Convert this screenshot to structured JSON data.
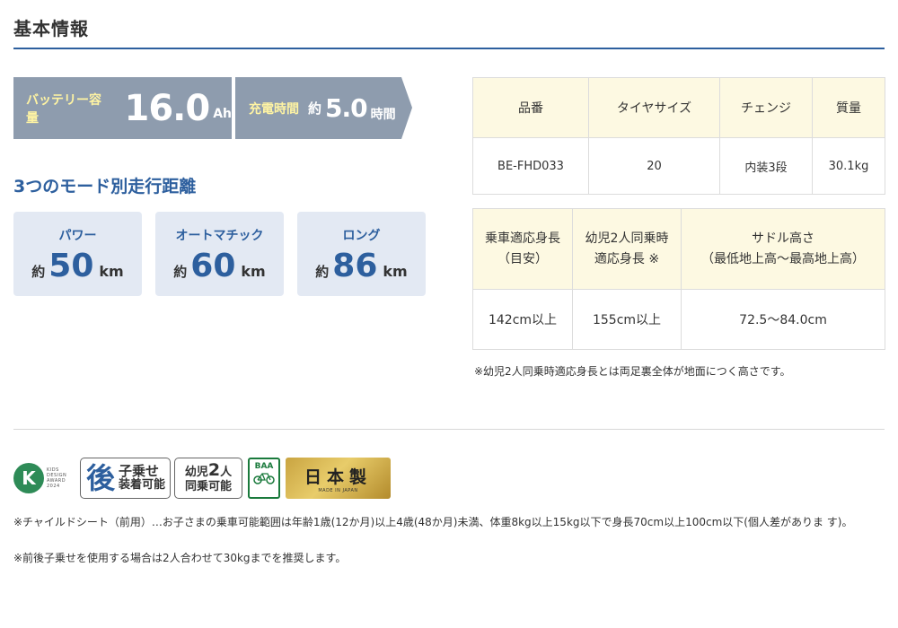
{
  "section_title": "基本情報",
  "spec": {
    "battery_label": "バッテリー容量",
    "battery_value": "16.0",
    "battery_unit": "Ah",
    "charge_label": "充電時間",
    "charge_approx": "約",
    "charge_value": "5.0",
    "charge_unit": "時間"
  },
  "modes_title": "3つのモード別走行距離",
  "modes": [
    {
      "name": "パワー",
      "approx": "約",
      "distance": "50",
      "unit": "km"
    },
    {
      "name": "オートマチック",
      "approx": "約",
      "distance": "60",
      "unit": "km"
    },
    {
      "name": "ロング",
      "approx": "約",
      "distance": "86",
      "unit": "km"
    }
  ],
  "table1": {
    "headers": [
      "品番",
      "タイヤサイズ",
      "チェンジ",
      "質量"
    ],
    "row": [
      "BE-FHD033",
      "20",
      "内装3段",
      "30.1kg"
    ]
  },
  "table2": {
    "headers": [
      [
        "乗車適応身長",
        "（目安）"
      ],
      [
        "幼児2人同乗時",
        "適応身長 ※"
      ],
      [
        "サドル高さ",
        "（最低地上高〜最高地上高）"
      ]
    ],
    "row": [
      "142cm以上",
      "155cm以上",
      "72.5〜84.0cm"
    ]
  },
  "table_note": "※幼児2人同乗時適応身長とは両足裏全体が地面につく高さです。",
  "badges": {
    "kids_letter": "K",
    "kids_text": [
      "KIDS",
      "DESIGN",
      "AWARD",
      "2024"
    ],
    "back_char": "後",
    "back_line1": "子乗せ",
    "back_line2": "装着可能",
    "two_line1a": "幼児",
    "two_line1b": "2",
    "two_line1c": "人",
    "two_line2": "同乗可能",
    "baa_label": "BAA",
    "japan_big": "日本製",
    "japan_small": "MADE IN JAPAN"
  },
  "notes": [
    "※チャイルドシート（前用）…お子さまの乗車可能範囲は年齢1歳(12か月)以上4歳(48か月)未満、体重8kg以上15kg以下で身長70cm以上100cm以下(個人差がありま す)。",
    "※前後子乗せを使用する場合は2人合わせて30kgまでを推奨します。"
  ]
}
